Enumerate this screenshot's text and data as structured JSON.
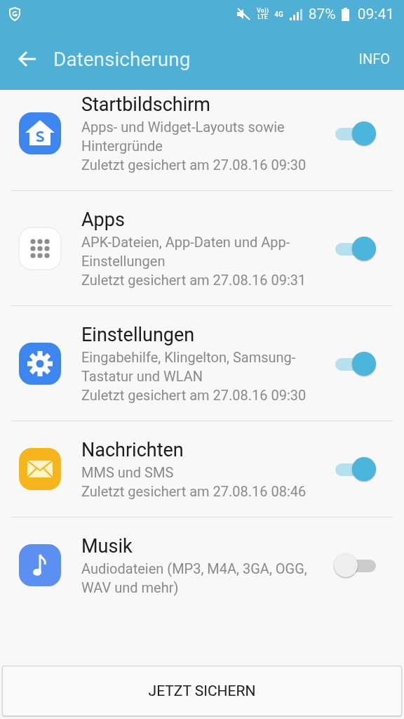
{
  "status_bar": {
    "network_lines": [
      "Vo))",
      "LTE"
    ],
    "network_type": "4G",
    "battery": "87%",
    "time": "09:41"
  },
  "app_bar": {
    "title": "Datensicherung",
    "action": "INFO"
  },
  "items": [
    {
      "title": "Startbildschirm",
      "description": "Apps- und Widget-Layouts sowie Hintergründe",
      "last_backup": "Zuletzt gesichert am 27.08.16 09:30",
      "on": true
    },
    {
      "title": "Apps",
      "description": "APK-Dateien, App-Daten und App-Einstellungen",
      "last_backup": "Zuletzt gesichert am 27.08.16 09:31",
      "on": true
    },
    {
      "title": "Einstellungen",
      "description": "Eingabehilfe, Klingelton, Samsung-Tastatur und WLAN",
      "last_backup": "Zuletzt gesichert am 27.08.16 09:30",
      "on": true
    },
    {
      "title": "Nachrichten",
      "description": "MMS und SMS",
      "last_backup": "Zuletzt gesichert am 27.08.16 08:46",
      "on": true
    },
    {
      "title": "Musik",
      "description": "Audiodateien (MP3, M4A, 3GA, OGG, WAV und mehr)",
      "on": false
    }
  ],
  "button": "JETZT SICHERN"
}
